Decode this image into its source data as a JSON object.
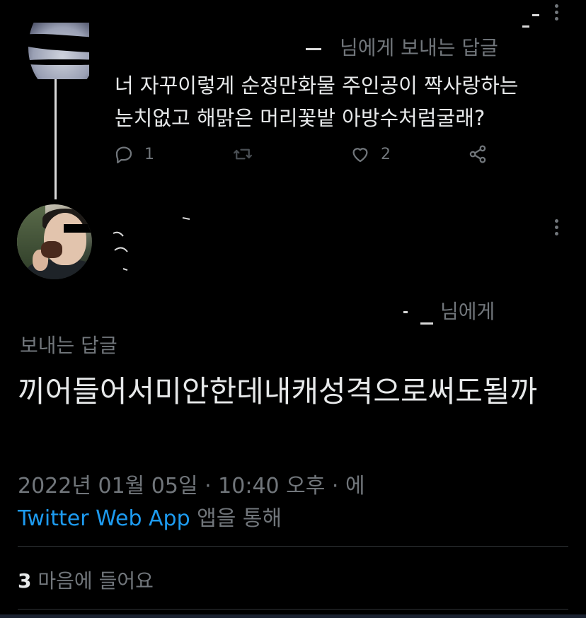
{
  "parent_tweet": {
    "reply_to": "님에게 보내는 답글",
    "text": "너 자꾸이렇게 순정만화물 주인공이 짝사랑하는\n눈치없고 해맑은 머리꽃밭 아방수처럼굴래?",
    "actions": {
      "reply_count": "1",
      "retweet_count": "",
      "like_count": "2"
    }
  },
  "main_tweet": {
    "reply_to_line1": "님에게",
    "reply_to_line2": "보내는 답글",
    "text": "끼어들어서미안한데내캐성격으로써도될까",
    "timestamp": "2022년 01월 05일 · 10:40 오후 · 에",
    "via_app": "Twitter Web App",
    "via_suffix": " 앱을 통해",
    "likes_count": "3",
    "likes_label": " 마음에 들어요"
  },
  "colors": {
    "background": "#000000",
    "text_primary": "#e7e9ea",
    "text_secondary": "#71767b",
    "accent": "#1d9bf0",
    "divider": "#2f3336"
  },
  "icons": [
    "reply-icon",
    "retweet-icon",
    "like-icon",
    "share-icon",
    "more-options-icon"
  ]
}
